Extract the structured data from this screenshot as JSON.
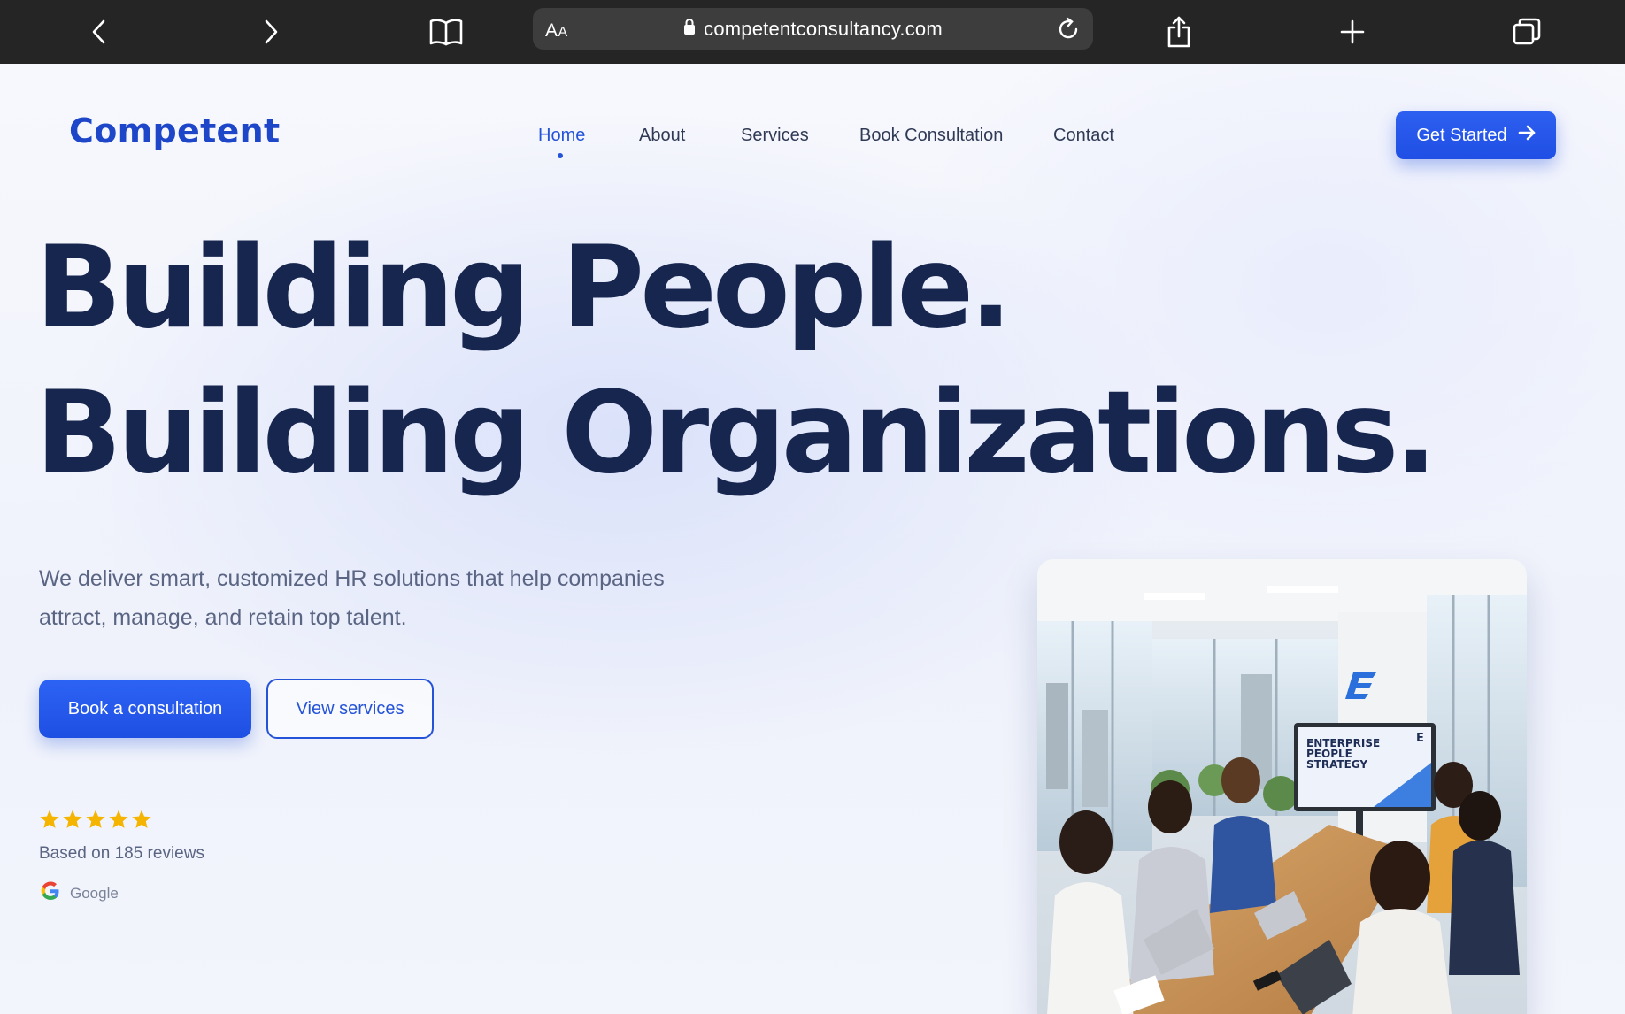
{
  "browser": {
    "aa_label_big": "A",
    "aa_label_small": "A",
    "url": "competentconsultancy.com"
  },
  "site": {
    "logo": "Competent",
    "nav": [
      {
        "label": "Home",
        "active": true
      },
      {
        "label": "About",
        "active": false
      },
      {
        "label": "Services",
        "active": false
      },
      {
        "label": "Book Consultation",
        "active": false
      },
      {
        "label": "Contact",
        "active": false
      }
    ],
    "cta": "Get Started"
  },
  "hero": {
    "headline_line1": "Building People.",
    "headline_line2": "Building Organizations.",
    "subtext": "We deliver smart, customized HR solutions that help companies attract, manage, and retain top talent.",
    "primary_button": "Book a consultation",
    "secondary_button": "View services",
    "rating": 5,
    "reviews_text": "Based on 185 reviews",
    "review_source": "Google"
  },
  "photo": {
    "screen_line1": "ENTERPRISE",
    "screen_line2": "PEOPLE",
    "screen_line3": "STRATEGY",
    "logo_letter": "E"
  },
  "colors": {
    "brand_blue": "#1d46c9",
    "button_blue": "#2553d8",
    "headline_navy": "#17264f",
    "star_gold": "#f4b400"
  }
}
